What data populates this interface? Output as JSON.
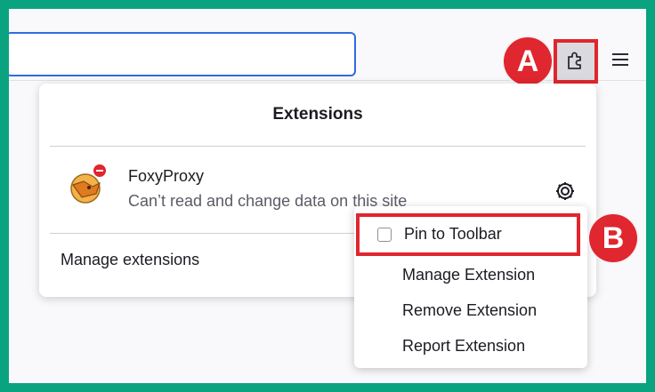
{
  "panel": {
    "title": "Extensions",
    "extension": {
      "name": "FoxyProxy",
      "status": "Can’t read and change data on this site",
      "icon": "foxyproxy-fox-icon"
    },
    "manage_label": "Manage extensions"
  },
  "context_menu": {
    "pin_label": "Pin to Toolbar",
    "pin_checked": false,
    "items": [
      "Manage Extension",
      "Remove Extension",
      "Report Extension"
    ]
  },
  "callouts": {
    "a": "A",
    "b": "B"
  },
  "toolbar": {
    "extensions_icon": "puzzle-icon",
    "menu_icon": "hamburger-menu-icon"
  },
  "colors": {
    "frame_border": "#0aa37f",
    "highlight": "#e0262e",
    "urlbar_focus": "#2f6cde"
  }
}
